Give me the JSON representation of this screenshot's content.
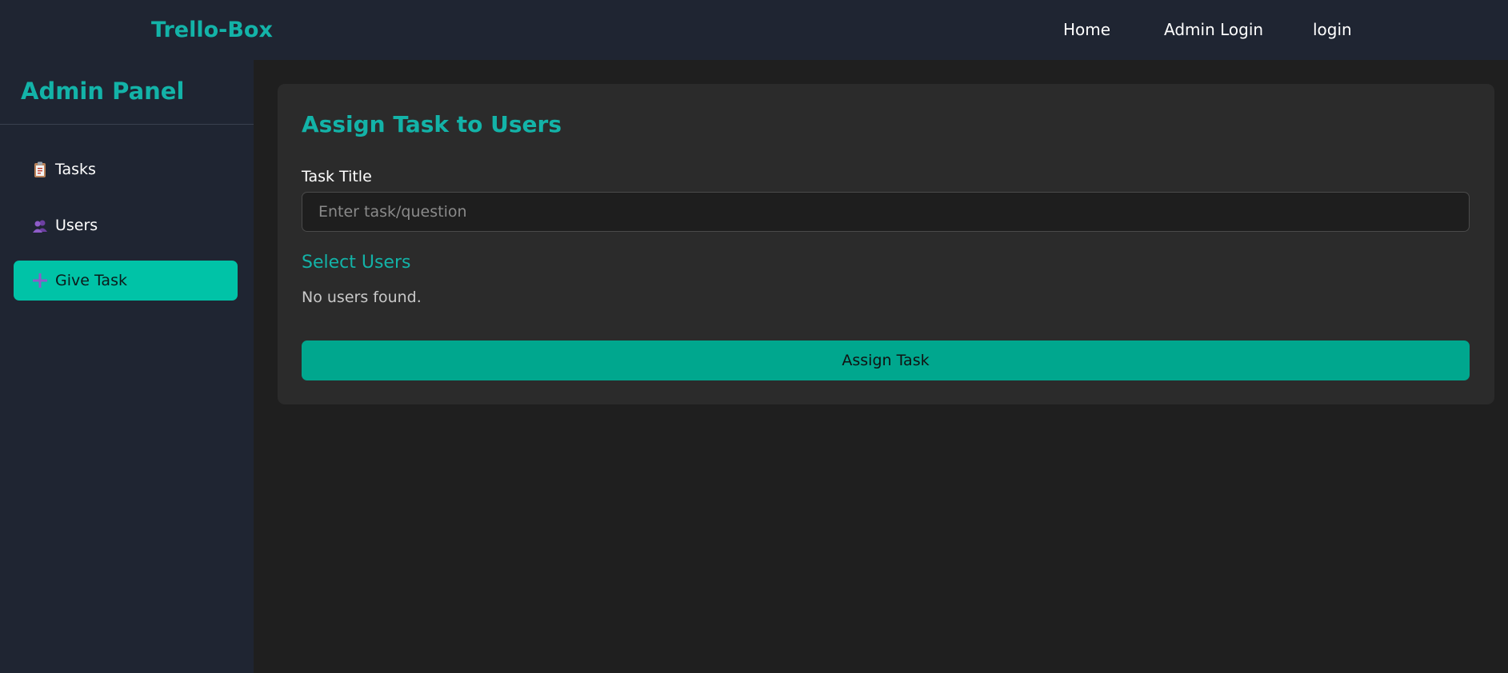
{
  "navbar": {
    "brand": "Trello-Box",
    "links": [
      "Home",
      "Admin Login",
      "login"
    ]
  },
  "sidebar": {
    "title": "Admin Panel",
    "items": [
      {
        "label": "Tasks",
        "icon": "clipboard-icon",
        "active": false
      },
      {
        "label": "Users",
        "icon": "users-icon",
        "active": false
      },
      {
        "label": "Give Task",
        "icon": "plus-icon",
        "active": true
      }
    ]
  },
  "main": {
    "title": "Assign Task to Users",
    "task_title_label": "Task Title",
    "task_input": {
      "value": "",
      "placeholder": "Enter task/question"
    },
    "select_users_title": "Select Users",
    "empty_message": "No users found.",
    "assign_button_label": "Assign Task"
  },
  "colors": {
    "accent": "#13b3a8",
    "active_item": "#00c3a7",
    "button": "#00a78e",
    "panel_bg": "#1f2532",
    "page_bg": "#1f1f1f",
    "card_bg": "#2b2b2b"
  }
}
